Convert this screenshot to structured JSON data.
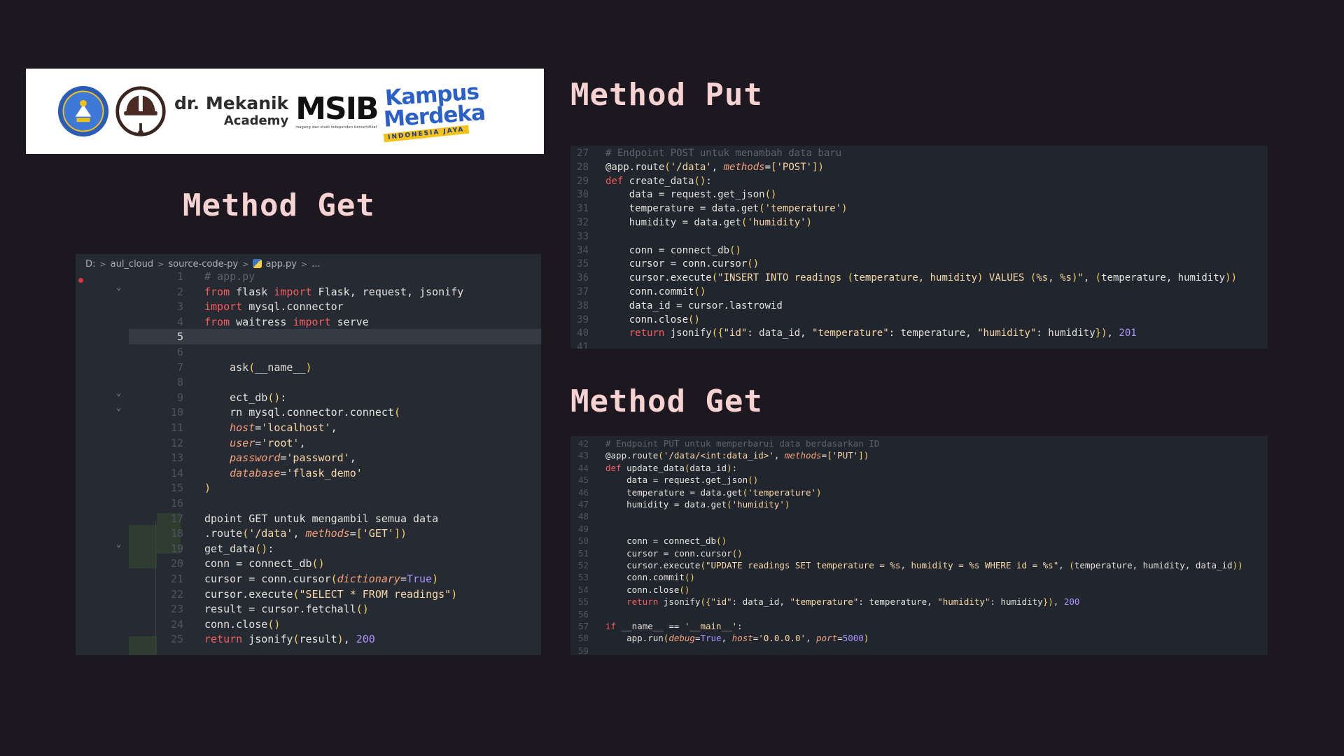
{
  "headings": {
    "put": "Method Put",
    "get_left": "Method Get",
    "get_right": "Method Get"
  },
  "banner": {
    "mechanic_line1": "dr. Mekanik",
    "mechanic_line2": "Academy",
    "msib": "MSIB",
    "msib_tagline": "magang dan studi independen bersertifikat",
    "kampus_line1": "Kampus",
    "kampus_line2": "Merdeka",
    "kampus_line3": "INDONESIA JAYA"
  },
  "editor_left": {
    "breadcrumb": [
      "D:",
      "aul_cloud",
      "source-code-py",
      "app.py",
      "..."
    ],
    "active_line": "5",
    "lines": [
      {
        "n": "1",
        "code": "# app.py"
      },
      {
        "n": "2",
        "code": "from flask import Flask, request, jsonify"
      },
      {
        "n": "3",
        "code": "import mysql.connector"
      },
      {
        "n": "4",
        "code": "from waitress import serve"
      },
      {
        "n": "5",
        "code": ""
      },
      {
        "n": "6",
        "code": ""
      },
      {
        "n": "7",
        "code": "    ask(__name__)"
      },
      {
        "n": "8",
        "code": ""
      },
      {
        "n": "9",
        "code": "    ect_db():"
      },
      {
        "n": "10",
        "code": "    rn mysql.connector.connect("
      },
      {
        "n": "11",
        "code": "    host='localhost',"
      },
      {
        "n": "12",
        "code": "    user='root',"
      },
      {
        "n": "13",
        "code": "    password='password',"
      },
      {
        "n": "14",
        "code": "    database='flask_demo'"
      },
      {
        "n": "15",
        "code": ")"
      },
      {
        "n": "16",
        "code": ""
      },
      {
        "n": "17",
        "code": "dpoint GET untuk mengambil semua data"
      },
      {
        "n": "18",
        "code": ".route('/data', methods=['GET'])"
      },
      {
        "n": "19",
        "code": "get_data():"
      },
      {
        "n": "20",
        "code": "conn = connect_db()"
      },
      {
        "n": "21",
        "code": "cursor = conn.cursor(dictionary=True)"
      },
      {
        "n": "22",
        "code": "cursor.execute(\"SELECT * FROM readings\")"
      },
      {
        "n": "23",
        "code": "result = cursor.fetchall()"
      },
      {
        "n": "24",
        "code": "conn.close()"
      },
      {
        "n": "25",
        "code": "return jsonify(result), 200"
      }
    ]
  },
  "editor_put": {
    "lines": [
      {
        "n": "27",
        "code": "# Endpoint POST untuk menambah data baru"
      },
      {
        "n": "28",
        "code": "@app.route('/data', methods=['POST'])"
      },
      {
        "n": "29",
        "code": "def create_data():"
      },
      {
        "n": "30",
        "code": "    data = request.get_json()"
      },
      {
        "n": "31",
        "code": "    temperature = data.get('temperature')"
      },
      {
        "n": "32",
        "code": "    humidity = data.get('humidity')"
      },
      {
        "n": "33",
        "code": ""
      },
      {
        "n": "34",
        "code": "    conn = connect_db()"
      },
      {
        "n": "35",
        "code": "    cursor = conn.cursor()"
      },
      {
        "n": "36",
        "code": "    cursor.execute(\"INSERT INTO readings (temperature, humidity) VALUES (%s, %s)\", (temperature, humidity))"
      },
      {
        "n": "37",
        "code": "    conn.commit()"
      },
      {
        "n": "38",
        "code": "    data_id = cursor.lastrowid"
      },
      {
        "n": "39",
        "code": "    conn.close()"
      },
      {
        "n": "40",
        "code": "    return jsonify({\"id\": data_id, \"temperature\": temperature, \"humidity\": humidity}), 201"
      },
      {
        "n": "41",
        "code": ""
      }
    ]
  },
  "editor_get2": {
    "lines": [
      {
        "n": "42",
        "code": "# Endpoint PUT untuk memperbarui data berdasarkan ID"
      },
      {
        "n": "43",
        "code": "@app.route('/data/<int:data_id>', methods=['PUT'])"
      },
      {
        "n": "44",
        "code": "def update_data(data_id):"
      },
      {
        "n": "45",
        "code": "    data = request.get_json()"
      },
      {
        "n": "46",
        "code": "    temperature = data.get('temperature')"
      },
      {
        "n": "47",
        "code": "    humidity = data.get('humidity')"
      },
      {
        "n": "48",
        "code": ""
      },
      {
        "n": "49",
        "code": ""
      },
      {
        "n": "50",
        "code": "    conn = connect_db()"
      },
      {
        "n": "51",
        "code": "    cursor = conn.cursor()"
      },
      {
        "n": "52",
        "code": "    cursor.execute(\"UPDATE readings SET temperature = %s, humidity = %s WHERE id = %s\", (temperature, humidity, data_id))"
      },
      {
        "n": "53",
        "code": "    conn.commit()"
      },
      {
        "n": "54",
        "code": "    conn.close()"
      },
      {
        "n": "55",
        "code": "    return jsonify({\"id\": data_id, \"temperature\": temperature, \"humidity\": humidity}), 200"
      },
      {
        "n": "56",
        "code": ""
      },
      {
        "n": "57",
        "code": "if __name__ == '__main__':"
      },
      {
        "n": "58",
        "code": "    app.run(debug=True, host='0.0.0.0', port=5000)"
      },
      {
        "n": "59",
        "code": ""
      }
    ]
  }
}
